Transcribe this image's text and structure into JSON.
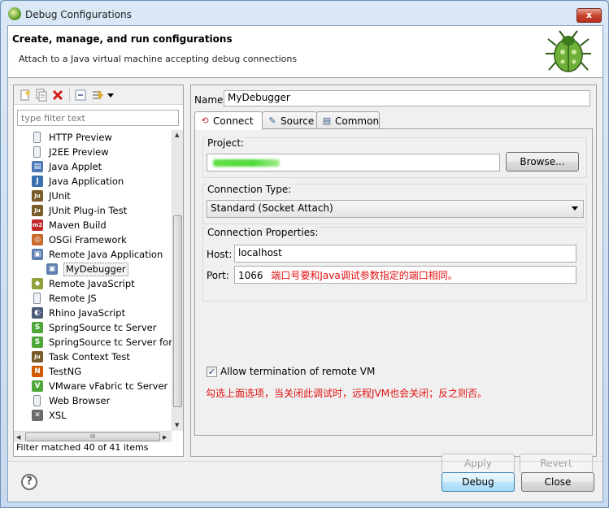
{
  "window": {
    "title": "Debug Configurations",
    "close_glyph": "x"
  },
  "header": {
    "title": "Create, manage, and run configurations",
    "subtitle": "Attach to a Java virtual machine accepting debug connections",
    "icon": "bug-icon"
  },
  "left": {
    "filter_placeholder": "type filter text",
    "tree": [
      {
        "label": "HTTP Preview",
        "icon": "page-icon",
        "color": "#7c8a99",
        "glyph": ""
      },
      {
        "label": "J2EE Preview",
        "icon": "page-icon",
        "color": "#7c8a99",
        "glyph": ""
      },
      {
        "label": "Java Applet",
        "icon": "applet-icon",
        "color": "#4a79b5",
        "glyph": "▤"
      },
      {
        "label": "Java Application",
        "icon": "java-app-icon",
        "color": "#3a6fb0",
        "glyph": "J"
      },
      {
        "label": "JUnit",
        "icon": "junit-icon",
        "color": "#7a5b2a",
        "glyph": "Ju"
      },
      {
        "label": "JUnit Plug-in Test",
        "icon": "junit-plugin-icon",
        "color": "#7a5b2a",
        "glyph": "Ju"
      },
      {
        "label": "Maven Build",
        "icon": "maven-icon",
        "color": "#c0272d",
        "glyph": "m2"
      },
      {
        "label": "OSGi Framework",
        "icon": "osgi-icon",
        "color": "#c96a2b",
        "glyph": "◎"
      },
      {
        "label": "Remote Java Application",
        "icon": "remote-java-icon",
        "color": "#5d7fae",
        "glyph": "▣"
      },
      {
        "label": "MyDebugger",
        "icon": "debug-config-icon",
        "color": "#5d7fae",
        "glyph": "▣",
        "child": true,
        "selected": true
      },
      {
        "label": "Remote JavaScript",
        "icon": "remote-js-icon",
        "color": "#8fa13a",
        "glyph": "◆"
      },
      {
        "label": "Remote JS",
        "icon": "remote-js2-icon",
        "color": "#7c8a99",
        "glyph": ""
      },
      {
        "label": "Rhino JavaScript",
        "icon": "rhino-icon",
        "color": "#4b5c7a",
        "glyph": "◐"
      },
      {
        "label": "SpringSource tc Server",
        "icon": "spring-icon",
        "color": "#4fa63a",
        "glyph": "S"
      },
      {
        "label": "SpringSource tc Server for",
        "icon": "spring-icon",
        "color": "#4fa63a",
        "glyph": "S"
      },
      {
        "label": "Task Context Test",
        "icon": "task-test-icon",
        "color": "#7a5b2a",
        "glyph": "Ju"
      },
      {
        "label": "TestNG",
        "icon": "testng-icon",
        "color": "#d15a00",
        "glyph": "N"
      },
      {
        "label": "VMware vFabric tc Server",
        "icon": "vfabric-icon",
        "color": "#4fa63a",
        "glyph": "V"
      },
      {
        "label": "Web Browser",
        "icon": "browser-icon",
        "color": "#7c8a99",
        "glyph": ""
      },
      {
        "label": "XSL",
        "icon": "xsl-icon",
        "color": "#6a6a6a",
        "glyph": "✕"
      }
    ],
    "hscroll_grip": "III",
    "status": "Filter matched 40 of 41 items"
  },
  "right": {
    "name_label": "Name:",
    "name_value": "MyDebugger",
    "tabs": [
      {
        "label": "Connect",
        "icon": "connect-icon",
        "glyph": "⟲"
      },
      {
        "label": "Source",
        "icon": "source-icon",
        "glyph": "✎"
      },
      {
        "label": "Common",
        "icon": "common-icon",
        "glyph": "▤"
      }
    ],
    "project_label": "Project:",
    "browse_label": "Browse...",
    "connection_type_label": "Connection Type:",
    "connection_type_value": "Standard (Socket Attach)",
    "connection_props_label": "Connection Properties:",
    "host_label": "Host:",
    "host_value": "localhost",
    "port_label": "Port:",
    "port_value": "1066",
    "port_note": "端口号要和Java调试参数指定的端口相同。",
    "allow_label": "Allow termination of remote VM",
    "allow_checked": "✓",
    "allow_note": "勾选上面选项，当关闭此调试时，远程JVM也会关闭；反之则否。",
    "apply_label": "Apply",
    "revert_label": "Revert"
  },
  "footer": {
    "help_glyph": "?",
    "debug_label": "Debug",
    "close_label": "Close"
  }
}
